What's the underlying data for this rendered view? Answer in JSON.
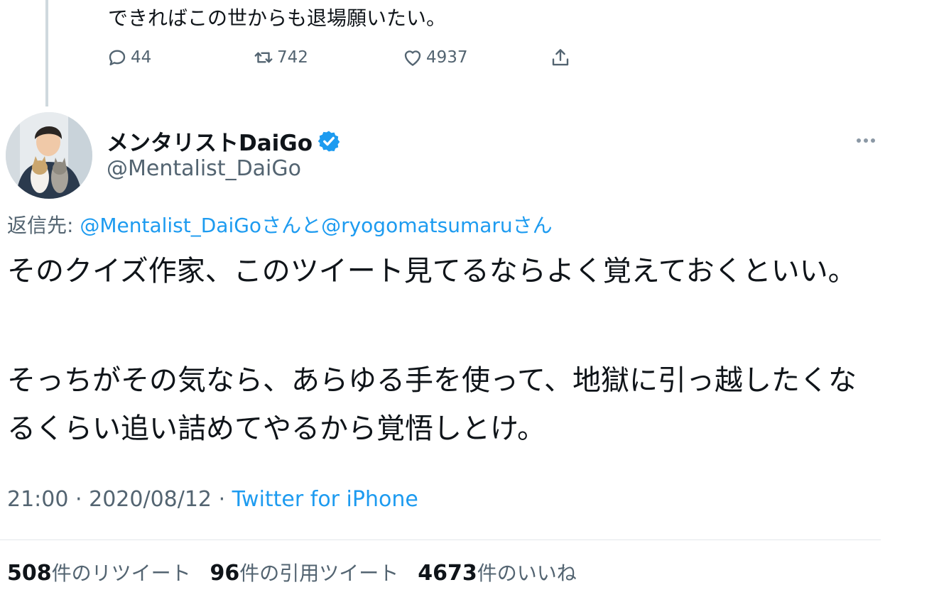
{
  "previous_tweet": {
    "text": "できればこの世からも退場願いたい。",
    "reply_count": "44",
    "retweet_count": "742",
    "like_count": "4937"
  },
  "tweet": {
    "display_name": "メンタリストDaiGo",
    "handle": "@Mentalist_DaiGo",
    "reply_to_label": "返信先:",
    "reply_to_user1": "@Mentalist_DaiGo",
    "reply_to_join": "さんと",
    "reply_to_user2": "@ryogomatsumaru",
    "reply_to_suffix": "さん",
    "paragraph1": "そのクイズ作家、このツイート見てるならよく覚えておくといい。",
    "paragraph2": "そっちがその気なら、あらゆる手を使って、地獄に引っ越したくなるくらい追い詰めてやるから覚悟しとけ。",
    "time": "21:00",
    "date": "2020/08/12",
    "separator": "·",
    "source": "Twitter for iPhone",
    "retweets_count": "508",
    "retweets_label": "件のリツイート",
    "quotes_count": "96",
    "quotes_label": "件の引用ツイート",
    "likes_count": "4673",
    "likes_label": "件のいいね"
  },
  "icons": {
    "reply": "reply-icon",
    "retweet": "retweet-icon",
    "like": "heart-icon",
    "share": "share-icon",
    "verified": "verified-badge-icon",
    "more": "more-options-icon"
  },
  "colors": {
    "link": "#1d9bf0",
    "secondary_text": "#536471",
    "verified": "#1d9bf0"
  }
}
